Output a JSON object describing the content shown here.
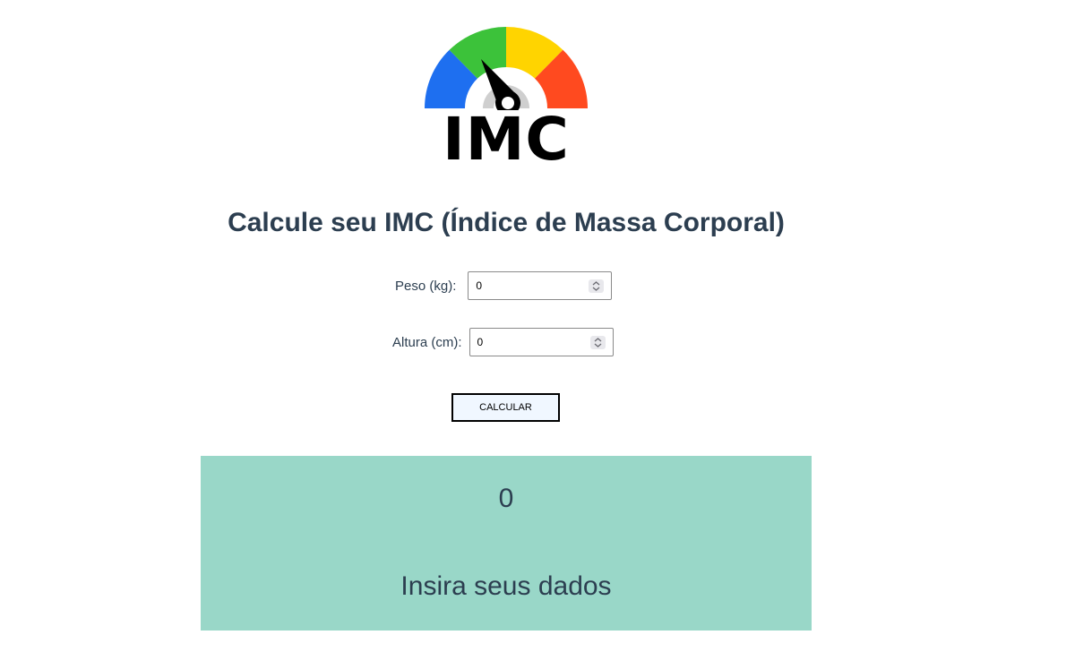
{
  "app": {
    "logo_text": "IMC",
    "title": "Calcule seu IMC (Índice de Massa Corporal)"
  },
  "form": {
    "peso": {
      "label": "Peso (kg):",
      "value": "0"
    },
    "altura": {
      "label": "Altura (cm):",
      "value": "0"
    },
    "submit_label": "CALCULAR"
  },
  "result": {
    "value": "0",
    "message": "Insira seus dados"
  },
  "colors": {
    "heading": "#2c3e50",
    "result_bg": "#99d7c8",
    "gauge_blue": "#1e6ff0",
    "gauge_green": "#3cc23a",
    "gauge_yellow": "#ffd400",
    "gauge_red": "#ff4a1f"
  },
  "icons": {
    "logo": "bmi-gauge-logo",
    "spinner": "number-spinner-icon"
  }
}
